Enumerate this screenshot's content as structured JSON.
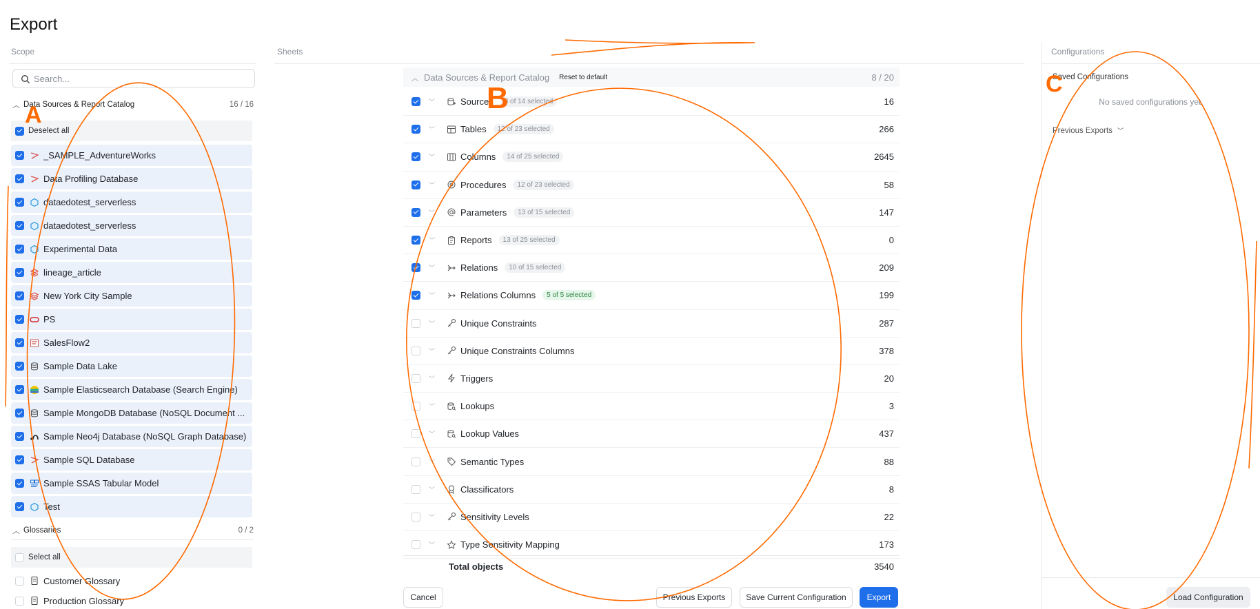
{
  "page": {
    "title": "Export"
  },
  "columns": {
    "scope": "Scope",
    "sheets": "Sheets",
    "configurations": "Configurations"
  },
  "scope": {
    "search_placeholder": "Search...",
    "catalog": {
      "title": "Data Sources & Report Catalog",
      "count": "16 / 16",
      "toggle_all_label": "Deselect all",
      "items": [
        {
          "label": "_SAMPLE_AdventureWorks",
          "icon": "sql-server-icon",
          "checked": true
        },
        {
          "label": "Data Profiling Database",
          "icon": "sql-server-icon",
          "checked": true
        },
        {
          "label": "dataedotest_serverless",
          "icon": "cube-icon",
          "checked": true
        },
        {
          "label": "dataedotest_serverless",
          "icon": "cube-icon",
          "checked": true
        },
        {
          "label": "Experimental Data",
          "icon": "cube-icon",
          "checked": true
        },
        {
          "label": "lineage_article",
          "icon": "layers-icon",
          "checked": true
        },
        {
          "label": "New York City Sample",
          "icon": "layers-icon",
          "checked": true
        },
        {
          "label": "PS",
          "icon": "oracle-icon",
          "checked": true
        },
        {
          "label": "SalesFlow2",
          "icon": "ssis-icon",
          "checked": true
        },
        {
          "label": "Sample Data Lake",
          "icon": "database-icon",
          "checked": true
        },
        {
          "label": "Sample Elasticsearch Database (Search Engine)",
          "icon": "elasticsearch-icon",
          "checked": true
        },
        {
          "label": "Sample MongoDB Database (NoSQL Document ...",
          "icon": "database-icon",
          "checked": true
        },
        {
          "label": "Sample Neo4j Database (NoSQL Graph Database)",
          "icon": "neo4j-icon",
          "checked": true
        },
        {
          "label": "Sample SQL Database",
          "icon": "sql-server-icon",
          "checked": true
        },
        {
          "label": "Sample SSAS Tabular Model",
          "icon": "ssas-icon",
          "checked": true
        },
        {
          "label": "Test",
          "icon": "cube-icon",
          "checked": true
        }
      ]
    },
    "glossaries": {
      "title": "Glossaries",
      "count": "0 / 2",
      "toggle_all_label": "Select all",
      "items": [
        {
          "label": "Customer Glossary",
          "icon": "glossary-icon",
          "checked": false
        },
        {
          "label": "Production Glossary",
          "icon": "glossary-icon",
          "checked": false
        }
      ]
    }
  },
  "sheets": {
    "header": {
      "title": "Data Sources & Report Catalog",
      "reset_label": "Reset to default",
      "count": "8 / 20"
    },
    "rows": [
      {
        "name": "Sources",
        "icon": "sources-icon",
        "badge": "8 of 14 selected",
        "badge_style": "grey",
        "count": "16",
        "checked": true
      },
      {
        "name": "Tables",
        "icon": "table-icon",
        "badge": "12 of 23 selected",
        "badge_style": "grey",
        "count": "266",
        "checked": true
      },
      {
        "name": "Columns",
        "icon": "columns-icon",
        "badge": "14 of 25 selected",
        "badge_style": "grey",
        "count": "2645",
        "checked": true
      },
      {
        "name": "Procedures",
        "icon": "procedure-icon",
        "badge": "12 of 23 selected",
        "badge_style": "grey",
        "count": "58",
        "checked": true
      },
      {
        "name": "Parameters",
        "icon": "at-icon",
        "badge": "13 of 15 selected",
        "badge_style": "grey",
        "count": "147",
        "checked": true
      },
      {
        "name": "Reports",
        "icon": "clipboard-icon",
        "badge": "13 of 25 selected",
        "badge_style": "grey",
        "count": "0",
        "checked": true
      },
      {
        "name": "Relations",
        "icon": "relation-icon",
        "badge": "10 of 15 selected",
        "badge_style": "grey",
        "count": "209",
        "checked": true
      },
      {
        "name": "Relations Columns",
        "icon": "relation-icon",
        "badge": "5 of 5 selected",
        "badge_style": "green",
        "count": "199",
        "checked": true
      },
      {
        "name": "Unique Constraints",
        "icon": "key-icon",
        "badge": "",
        "badge_style": "",
        "count": "287",
        "checked": false
      },
      {
        "name": "Unique Constraints Columns",
        "icon": "key-icon",
        "badge": "",
        "badge_style": "",
        "count": "378",
        "checked": false
      },
      {
        "name": "Triggers",
        "icon": "bolt-icon",
        "badge": "",
        "badge_style": "",
        "count": "20",
        "checked": false
      },
      {
        "name": "Lookups",
        "icon": "lookup-icon",
        "badge": "",
        "badge_style": "",
        "count": "3",
        "checked": false
      },
      {
        "name": "Lookup Values",
        "icon": "lookup-icon",
        "badge": "",
        "badge_style": "",
        "count": "437",
        "checked": false
      },
      {
        "name": "Semantic Types",
        "icon": "tag-icon",
        "badge": "",
        "badge_style": "",
        "count": "88",
        "checked": false
      },
      {
        "name": "Classificators",
        "icon": "classificator-icon",
        "badge": "",
        "badge_style": "",
        "count": "8",
        "checked": false
      },
      {
        "name": "Sensitivity Levels",
        "icon": "key-icon",
        "badge": "",
        "badge_style": "",
        "count": "22",
        "checked": false
      },
      {
        "name": "Type Sensitivity Mapping",
        "icon": "star-icon",
        "badge": "",
        "badge_style": "",
        "count": "173",
        "checked": false
      }
    ],
    "total_label": "Total objects",
    "total_count": "3540"
  },
  "footer": {
    "cancel": "Cancel",
    "previous_exports": "Previous Exports",
    "save_config": "Save Current Configuration",
    "export": "Export",
    "load_config": "Load Configuration"
  },
  "configurations": {
    "saved_title": "Saved Configurations",
    "empty_text": "No saved configurations yet.",
    "previous_exports": "Previous Exports"
  },
  "annotations": {
    "a": "A",
    "b": "B",
    "c": "C"
  },
  "colors": {
    "accent": "#1f6feb",
    "annotation": "#ff6a00",
    "selected_row": "#eaf1fb"
  }
}
